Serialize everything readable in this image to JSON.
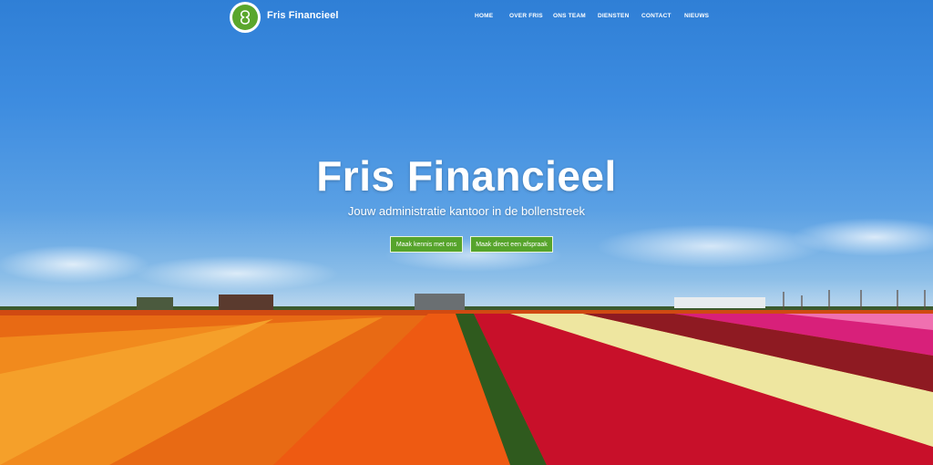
{
  "header": {
    "brand": "Fris Financieel",
    "nav": [
      "HOME",
      "OVER FRIS",
      "ONS TEAM",
      "DIENSTEN",
      "CONTACT",
      "NIEUWS"
    ]
  },
  "hero": {
    "title": "Fris Financieel",
    "subtitle": "Jouw administratie kantoor in de bollenstreek",
    "buttons": [
      "Maak kennis met ons",
      "Maak direct een afspraak"
    ]
  },
  "colors": {
    "accent_green": "#56a42b",
    "sky_blue": "#2f7fd6",
    "text": "#ffffff"
  },
  "icons": {
    "logo": "fris-logo-icon"
  }
}
